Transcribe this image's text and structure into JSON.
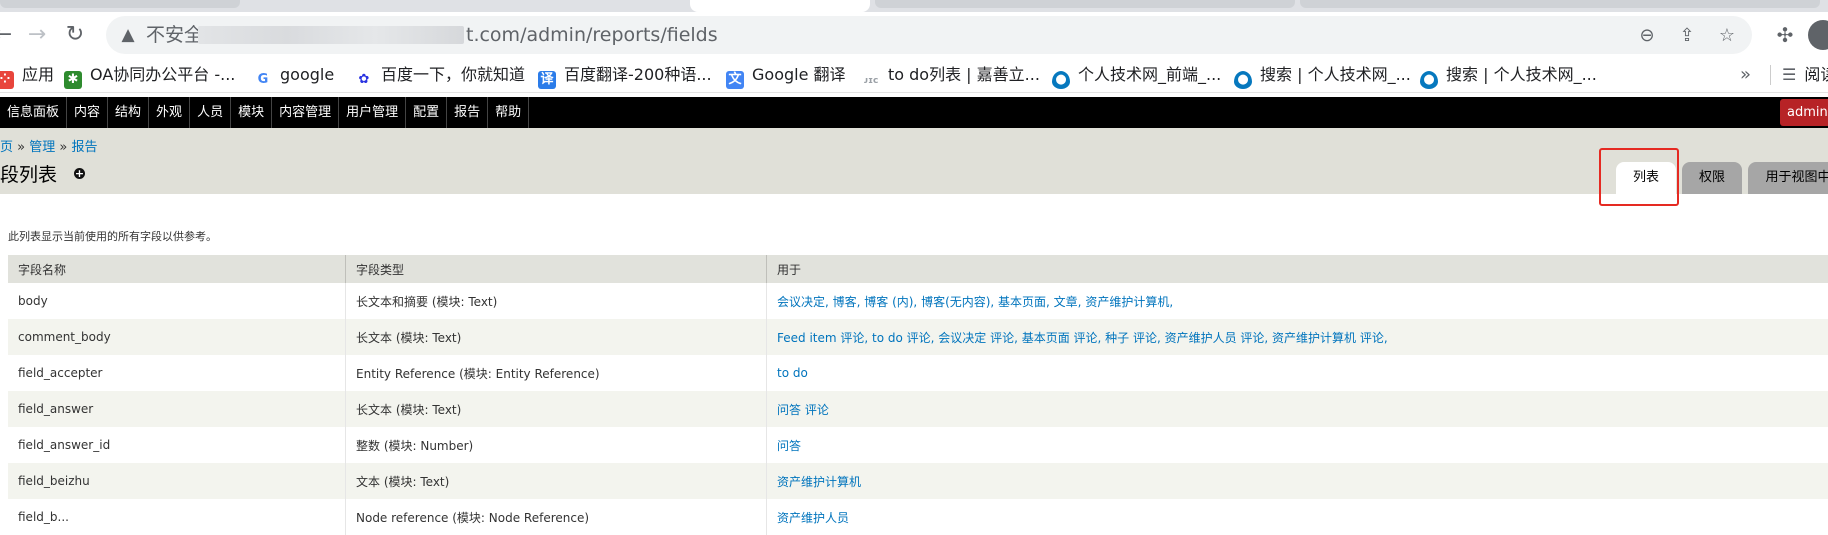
{
  "browser": {
    "not_secure": "不安全",
    "url": "t.com/admin/reports/fields"
  },
  "bookmarks": {
    "items": [
      {
        "label": "应用",
        "icon": "apps-grid-icon",
        "color": "#e8453c"
      },
      {
        "label": "OA协同办公平台 -...",
        "icon": "oa-gear-icon",
        "color": "#2e8b2e"
      },
      {
        "label": "google",
        "icon": "google-g-icon",
        "color": "#4285f4"
      },
      {
        "label": "百度一下，你就知道",
        "icon": "baidu-paw-icon",
        "color": "#2932e1"
      },
      {
        "label": "百度翻译-200种语...",
        "icon": "baidu-translate-icon",
        "color": "#2b7ce9"
      },
      {
        "label": "Google 翻译",
        "icon": "google-translate-icon",
        "color": "#4285f4"
      },
      {
        "label": "to do列表 | 嘉善立...",
        "icon": "todo-site-icon",
        "color": "#9aa0a6"
      },
      {
        "label": "个人技术网_前端_...",
        "icon": "drupal-drop-icon",
        "color": "#0678be"
      },
      {
        "label": "搜索 | 个人技术网_...",
        "icon": "drupal-drop-icon",
        "color": "#0678be"
      },
      {
        "label": "搜索 | 个人技术网_...",
        "icon": "drupal-drop-icon",
        "color": "#0678be"
      }
    ],
    "more": "»",
    "reading_list": "阅读"
  },
  "adminbar": {
    "menu": [
      "信息面板",
      "内容",
      "结构",
      "外观",
      "人员",
      "模块",
      "内容管理",
      "用户管理",
      "配置",
      "报告",
      "帮助"
    ],
    "user": "admin"
  },
  "header": {
    "breadcrumb": {
      "home": "页",
      "admin": "管理",
      "reports": "报告",
      "sep": " » "
    },
    "title": "字段列表",
    "tabs": [
      "列表",
      "权限",
      "用于视图中"
    ]
  },
  "content": {
    "description": "此列表显示当前使用的所有字段以供参考。",
    "columns": [
      "字段名称",
      "字段类型",
      "用于"
    ],
    "rows": [
      {
        "name": "body",
        "type": "长文本和摘要 (模块: Text)",
        "used_in": "会议决定, 博客, 博客 (内), 博客(无内容), 基本页面, 文章, 资产维护计算机,"
      },
      {
        "name": "comment_body",
        "type": "长文本 (模块: Text)",
        "used_in": "Feed item 评论, to do 评论, 会议决定 评论, 基本页面 评论, 种子 评论, 资产维护人员 评论, 资产维护计算机 评论,"
      },
      {
        "name": "field_accepter",
        "type": "Entity Reference (模块: Entity Reference)",
        "used_in": "to do"
      },
      {
        "name": "field_answer",
        "type": "长文本 (模块: Text)",
        "used_in": "问答 评论"
      },
      {
        "name": "field_answer_id",
        "type": "整数 (模块: Number)",
        "used_in": "问答"
      },
      {
        "name": "field_beizhu",
        "type": "文本 (模块: Text)",
        "used_in": "资产维护计算机"
      },
      {
        "name": "field_b...",
        "type": "Node reference (模块: Node Reference)",
        "used_in": "资产维护人员"
      }
    ]
  }
}
